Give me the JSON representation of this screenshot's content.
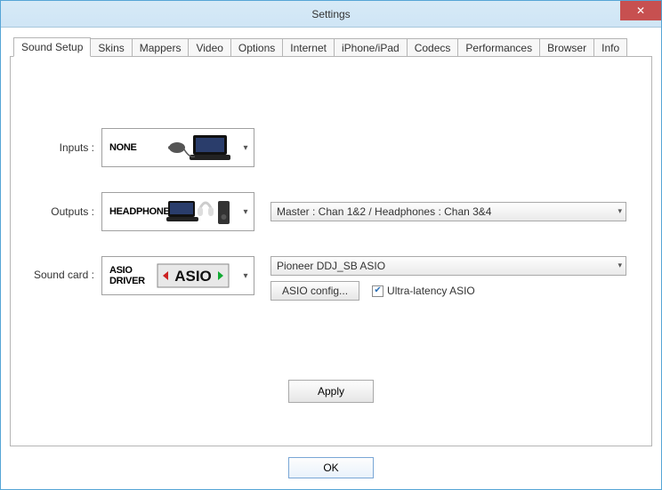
{
  "window": {
    "title": "Settings"
  },
  "tabs": [
    {
      "label": "Sound Setup",
      "active": true
    },
    {
      "label": "Skins"
    },
    {
      "label": "Mappers"
    },
    {
      "label": "Video"
    },
    {
      "label": "Options"
    },
    {
      "label": "Internet"
    },
    {
      "label": "iPhone/iPad"
    },
    {
      "label": "Codecs"
    },
    {
      "label": "Performances"
    },
    {
      "label": "Browser"
    },
    {
      "label": "Info"
    }
  ],
  "sound": {
    "inputs_label": "Inputs :",
    "inputs_value": "NONE",
    "outputs_label": "Outputs :",
    "outputs_value": "HEADPHONES",
    "outputs_channel": "Master : Chan 1&2 / Headphones : Chan 3&4",
    "soundcard_label": "Sound card :",
    "soundcard_value": "ASIO DRIVER",
    "soundcard_device": "Pioneer DDJ_SB ASIO",
    "asio_config_label": "ASIO config...",
    "ultra_latency_label": "Ultra-latency ASIO",
    "ultra_latency_checked": true,
    "asio_glyph": "ASIO"
  },
  "buttons": {
    "apply": "Apply",
    "ok": "OK"
  },
  "icons": {
    "close": "✕",
    "chev": "▾",
    "check": "✔"
  }
}
